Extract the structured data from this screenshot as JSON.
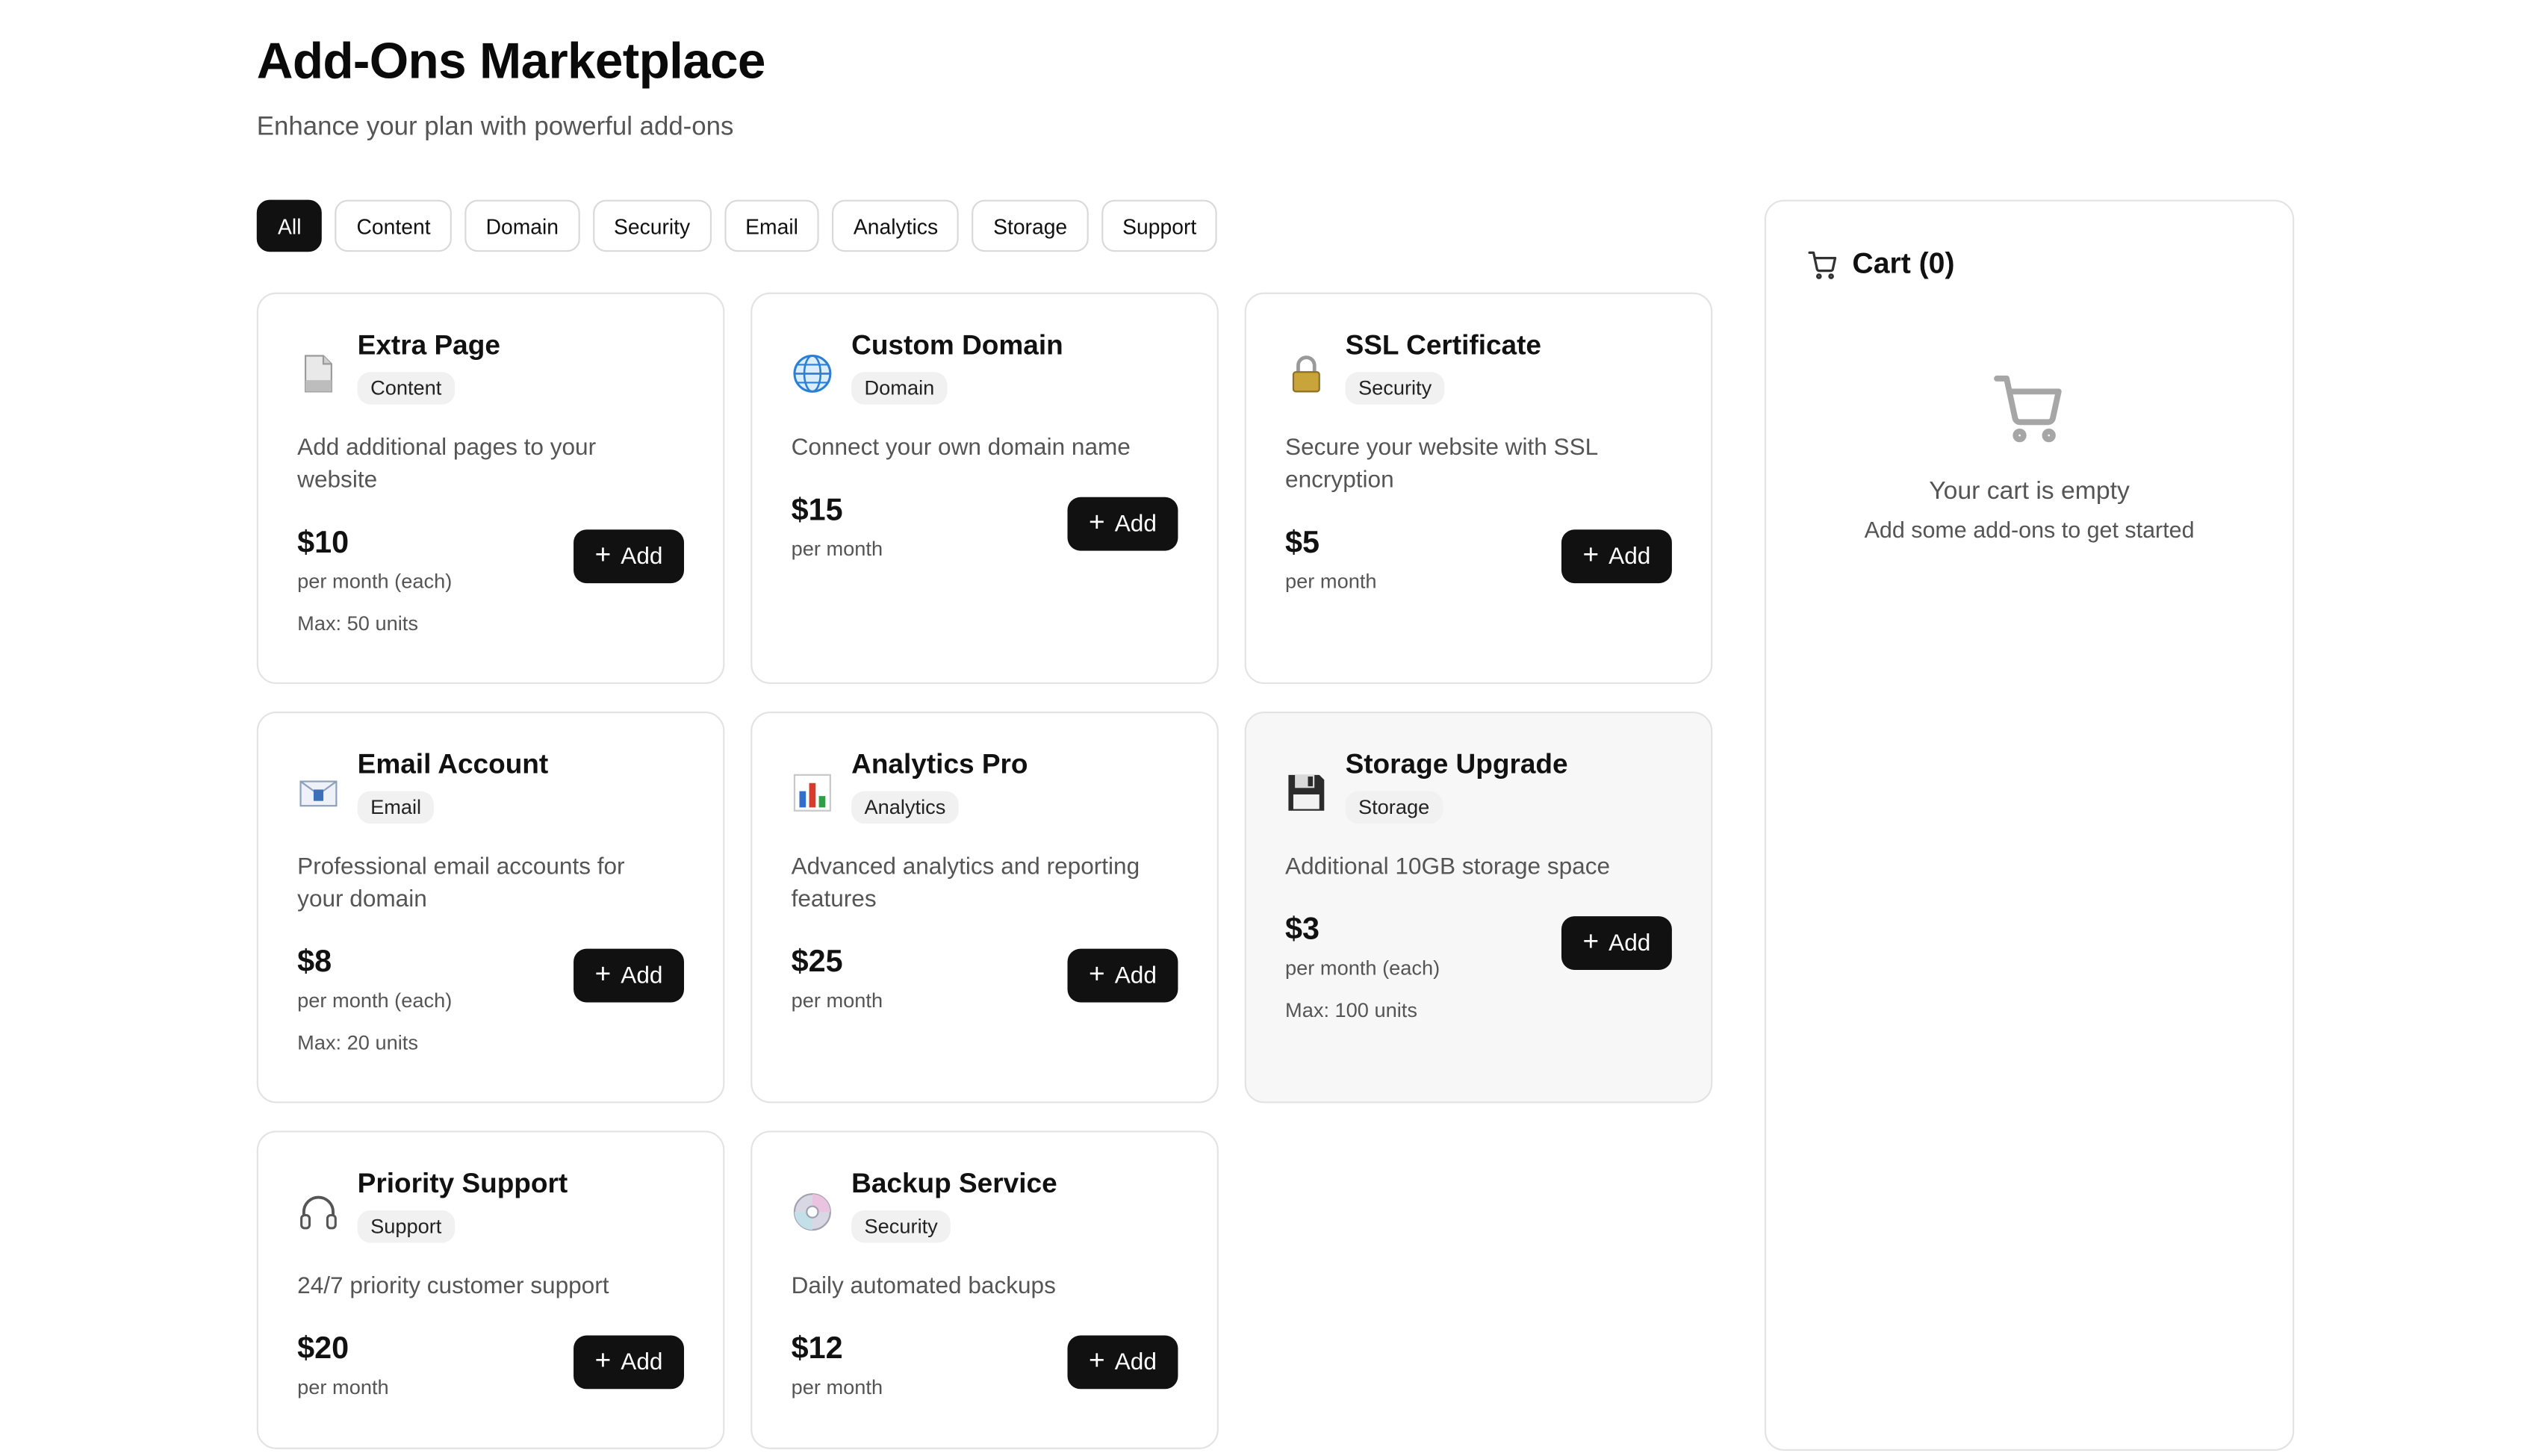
{
  "header": {
    "title": "Add-Ons Marketplace",
    "subtitle": "Enhance your plan with powerful add-ons"
  },
  "filters": [
    "All",
    "Content",
    "Domain",
    "Security",
    "Email",
    "Analytics",
    "Storage",
    "Support"
  ],
  "active_filter": "All",
  "add_label": "Add",
  "products": [
    {
      "name": "Extra Page",
      "category": "Content",
      "description": "Add additional pages to your website",
      "price": "$10",
      "unit": "per month (each)",
      "max": "Max: 50 units",
      "icon": "page-icon"
    },
    {
      "name": "Custom Domain",
      "category": "Domain",
      "description": "Connect your own domain name",
      "price": "$15",
      "unit": "per month",
      "max": "",
      "icon": "globe-icon"
    },
    {
      "name": "SSL Certificate",
      "category": "Security",
      "description": "Secure your website with SSL encryption",
      "price": "$5",
      "unit": "per month",
      "max": "",
      "icon": "lock-icon"
    },
    {
      "name": "Email Account",
      "category": "Email",
      "description": "Professional email accounts for your domain",
      "price": "$8",
      "unit": "per month (each)",
      "max": "Max: 20 units",
      "icon": "envelope-icon"
    },
    {
      "name": "Analytics Pro",
      "category": "Analytics",
      "description": "Advanced analytics and reporting features",
      "price": "$25",
      "unit": "per month",
      "max": "",
      "icon": "bar-chart-icon"
    },
    {
      "name": "Storage Upgrade",
      "category": "Storage",
      "description": "Additional 10GB storage space",
      "price": "$3",
      "unit": "per month (each)",
      "max": "Max: 100 units",
      "icon": "floppy-disk-icon"
    },
    {
      "name": "Priority Support",
      "category": "Support",
      "description": "24/7 priority customer support",
      "price": "$20",
      "unit": "per month",
      "max": "",
      "icon": "headphones-icon"
    },
    {
      "name": "Backup Service",
      "category": "Security",
      "description": "Daily automated backups",
      "price": "$12",
      "unit": "per month",
      "max": "",
      "icon": "disc-icon"
    }
  ],
  "cart": {
    "title": "Cart (0)",
    "empty_title": "Your cart is empty",
    "empty_subtitle": "Add some add-ons to get started"
  }
}
